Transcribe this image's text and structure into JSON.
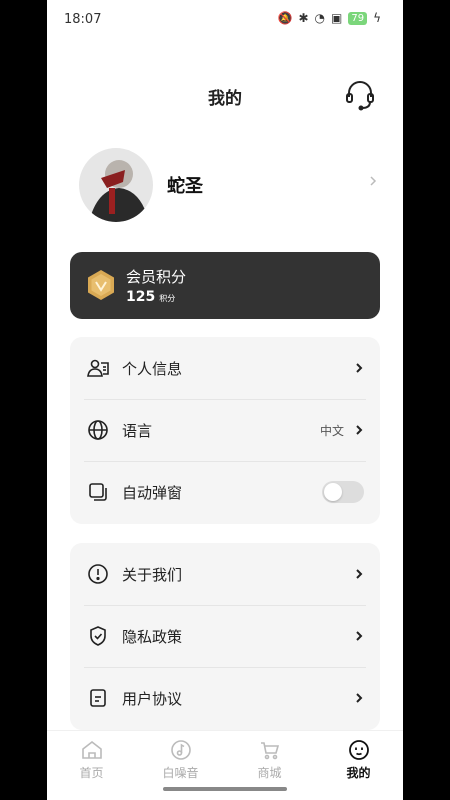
{
  "status_bar": {
    "time": "18:07",
    "battery": "79"
  },
  "header": {
    "title": "我的"
  },
  "profile": {
    "name": "蛇圣"
  },
  "points": {
    "label": "会员积分",
    "value": "125",
    "unit": "积分"
  },
  "settings": {
    "profile_info": "个人信息",
    "language": "语言",
    "language_value": "中文",
    "auto_popup": "自动弹窗"
  },
  "info": {
    "about": "关于我们",
    "privacy": "隐私政策",
    "agreement": "用户协议"
  },
  "tabs": [
    {
      "label": "首页"
    },
    {
      "label": "白噪音"
    },
    {
      "label": "商城"
    },
    {
      "label": "我的"
    }
  ],
  "colors": {
    "card_dark": "#333333",
    "card_light": "#f5f5f5",
    "badge_gold": "#d9a954"
  },
  "icons": [
    "headset-icon",
    "person-card-icon",
    "globe-icon",
    "square-stack-icon",
    "info-circle-icon",
    "shield-check-icon",
    "document-icon",
    "home-icon",
    "music-note-icon",
    "cart-icon",
    "smile-icon"
  ]
}
